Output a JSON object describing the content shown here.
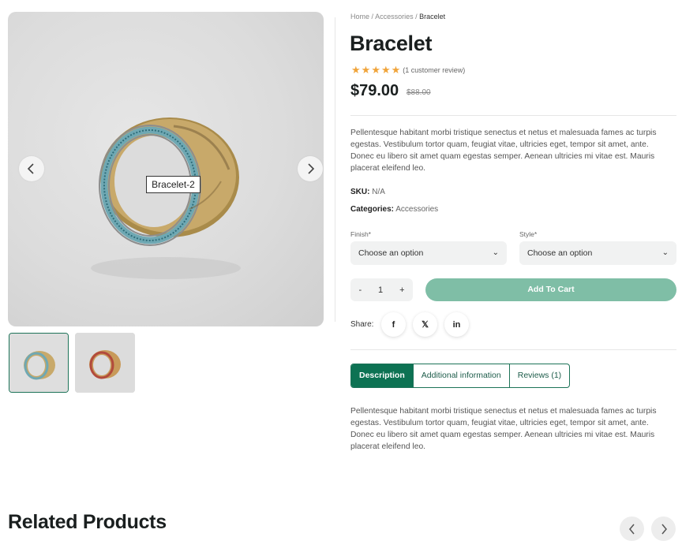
{
  "gallery": {
    "main_image_label": "Bracelet-2",
    "thumbnails": [
      {
        "name": "thumbnail-1",
        "active": true
      },
      {
        "name": "thumbnail-2",
        "active": false
      }
    ]
  },
  "breadcrumb": {
    "items": [
      "Home",
      "Accessories"
    ],
    "separator": "/",
    "current": "Bracelet"
  },
  "product": {
    "title": "Bracelet",
    "rating_stars": 5,
    "review_text": "(1 customer review)",
    "price": "$79.00",
    "old_price": "$88.00",
    "short_description": "Pellentesque habitant morbi tristique senectus et netus et malesuada fames ac turpis egestas. Vestibulum tortor quam, feugiat vitae, ultricies eget, tempor sit amet, ante. Donec eu libero sit amet quam egestas semper. Aenean ultricies mi vitae est. Mauris placerat eleifend leo.",
    "sku_label": "SKU:",
    "sku_value": "N/A",
    "categories_label": "Categories:",
    "categories_value": "Accessories"
  },
  "options": {
    "finish_label": "Finish*",
    "finish_value": "Choose an option",
    "style_label": "Style*",
    "style_value": "Choose an option"
  },
  "cart": {
    "minus": "-",
    "quantity": "1",
    "plus": "+",
    "add_label": "Add To Cart"
  },
  "share": {
    "label": "Share:",
    "facebook": "f",
    "x": "𝕏",
    "linkedin": "in"
  },
  "tabs": [
    {
      "label": "Description",
      "active": true
    },
    {
      "label": "Additional information",
      "active": false
    },
    {
      "label": "Reviews (1)",
      "active": false
    }
  ],
  "tab_content": "Pellentesque habitant morbi tristique senectus et netus et malesuada fames ac turpis egestas. Vestibulum tortor quam, feugiat vitae, ultricies eget, tempor sit amet, ante. Donec eu libero sit amet quam egestas semper. Aenean ultricies mi vitae est. Mauris placerat eleifend leo.",
  "related": {
    "title": "Related Products"
  },
  "colors": {
    "accent": "#0d7253",
    "add_to_cart": "#7fbea6",
    "star": "#f0a43a"
  }
}
